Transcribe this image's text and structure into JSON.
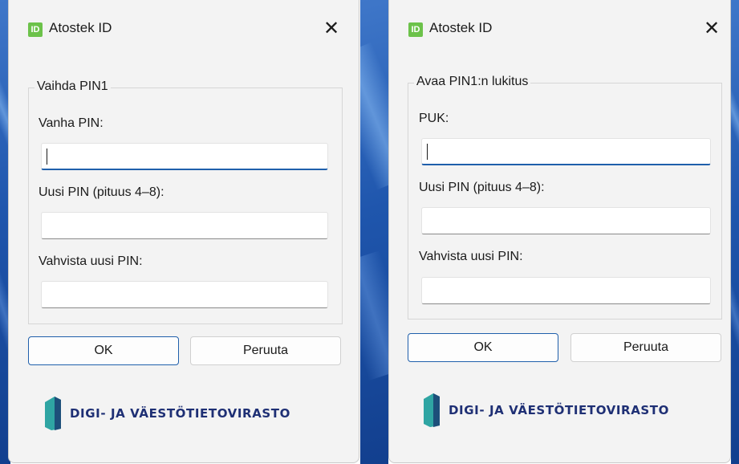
{
  "colors": {
    "app_icon": "#6cc24a",
    "focus_accent": "#1f5fab",
    "logo_text": "#1e2f74",
    "logo_mark_teal": "#2fa5a3",
    "logo_mark_dark": "#1d4f7a"
  },
  "dialogs": [
    {
      "app_icon_text": "ID",
      "title": "Atostek ID",
      "close_glyph": "✕",
      "group_title": "Vaihda PIN1",
      "fields": [
        {
          "label": "Vanha PIN:",
          "value": "",
          "focused": true
        },
        {
          "label": "Uusi PIN (pituus 4–8):",
          "value": ""
        },
        {
          "label": "Vahvista uusi PIN:",
          "value": ""
        }
      ],
      "ok_label": "OK",
      "cancel_label": "Peruuta",
      "logo_text": "DIGI- JA VÄESTÖTIETOVIRASTO"
    },
    {
      "app_icon_text": "ID",
      "title": "Atostek ID",
      "close_glyph": "✕",
      "group_title": "Avaa PIN1:n lukitus",
      "fields": [
        {
          "label": "PUK:",
          "value": "",
          "focused": true
        },
        {
          "label": "Uusi PIN (pituus 4–8):",
          "value": ""
        },
        {
          "label": "Vahvista uusi PIN:",
          "value": ""
        }
      ],
      "ok_label": "OK",
      "cancel_label": "Peruuta",
      "logo_text": "DIGI- JA VÄESTÖTIETOVIRASTO"
    }
  ]
}
